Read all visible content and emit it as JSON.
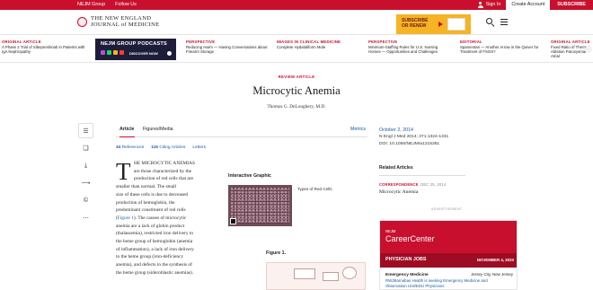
{
  "utility": {
    "nejm_group": "NEJM Group",
    "follow_us": "Follow Us",
    "sign_in": "Sign In",
    "create_account": "Create Account",
    "subscribe": "SUBSCRIBE"
  },
  "masthead": {
    "logo_line1": "THE NEW ENGLAND",
    "logo_line2": "JOURNAL of MEDICINE",
    "subscribe_ad": "SUBSCRIBE OR RENEW"
  },
  "teasers": [
    {
      "category": "ORIGINAL ARTICLE",
      "title": "A Phase 2 Trial of Sibeprenlimab in Patients with IgA Nephropathy"
    },
    {
      "category": "PERSPECTIVE",
      "title": "Reducing Harm — Having Conversations about Firearm Storage"
    },
    {
      "category": "IMAGES IN CLINICAL MEDICINE",
      "title": "Complete Hydatidiform Mole"
    },
    {
      "category": "PERSPECTIVE",
      "title": "Minimum-Staffing Rules for U.S. Nursing Homes — Opportunities and Challenges"
    },
    {
      "category": "EDITORIAL",
      "title": "Spamentan — Another Arrow in the Quiver for Treatment of FSGS?"
    },
    {
      "category": "ORIGINAL ARTICLE",
      "title": "Fixed Ratio of Thermal Ablation Paroxysmal Atrial"
    }
  ],
  "podcast": {
    "title": "NEJM GROUP PODCASTS",
    "cta": "DISCOVER NOW"
  },
  "article": {
    "type": "REVIEW ARTICLE",
    "title": "Microcytic Anemia",
    "author": "Thomas G. DeLoughery, M.D.",
    "tab_article": "Article",
    "tab_figures": "Figures/Media",
    "tab_metrics": "Metrics",
    "ref_count": "34",
    "ref_label": "References",
    "cite_count": "115",
    "cite_label": "Citing Articles",
    "letters": "Letters",
    "dropcap": "T",
    "body": [
      "HE MICROCYTIC ANEMIAS",
      "are those characterized by the",
      "production of red cells that are",
      "smaller than normal. The small",
      "size of these cells is due to decreased",
      "production of hemoglobin, the",
      "predominant constituent of red cells",
      "(Figure 1). The causes of microcytic",
      "anemia are a lack of globin product",
      "(thalassemia), restricted iron delivery to",
      "the heme group of hemoglobin (anemia",
      "of inflammation), a lack of iron delivery",
      "to the heme group (iron-deficiency",
      "anemia), and defects in the synthesis of",
      "the heme group (sideroblastic anemias)."
    ],
    "interactive_label": "Interactive Graphic",
    "interactive_caption": "Types of Red Cells",
    "figure_label": "Figure 1."
  },
  "citation": {
    "date": "October 2, 2014",
    "journal": "N Engl J Med 2014; 371:1324-1331",
    "doi": "DOI: 10.1056/NEJMra1215361"
  },
  "related": {
    "heading": "Related Articles",
    "category": "CORRESPONDENCE",
    "date": "DEC 25, 2014",
    "title": "Microcytic Anemia"
  },
  "ad": {
    "label": "ADVERTISEMENT",
    "brand_small": "NEJM",
    "brand": "CareerCenter",
    "jobs_label": "PHYSICIAN JOBS",
    "jobs_date": "NOVEMBER 4, 2023",
    "job_title": "Emergency Medicine",
    "job_location": "Jersey City, New Jersey",
    "job_org": "RWJBarnabas Health is seeking Emergency Medicine and",
    "job_org2": "Observation Unit/EDU Physicians"
  },
  "colors": {
    "brand_red": "#c8102e",
    "link_blue": "#1a5aa8",
    "ad_yellow": "#f6b323",
    "podcast_navy": "#1d1d3b"
  }
}
